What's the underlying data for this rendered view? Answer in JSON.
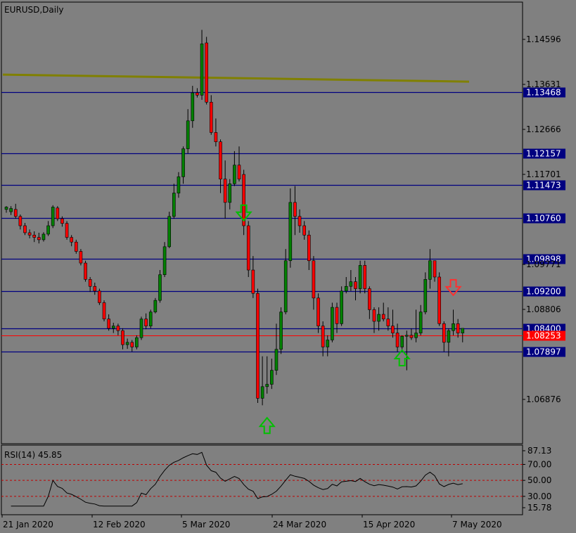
{
  "chart_data": {
    "type": "candlestick",
    "title": "EURUSD,Daily",
    "rsi_label": "RSI(14) 45.85",
    "price_ticks": [
      "1.14596",
      "1.13631",
      "1.12666",
      "1.11701",
      "1.09771",
      "1.08806",
      "1.06876"
    ],
    "horizontal_levels": [
      {
        "value": "1.13468",
        "price": 1.13468
      },
      {
        "value": "1.12157",
        "price": 1.12157
      },
      {
        "value": "1.11473",
        "price": 1.11473
      },
      {
        "value": "1.10760",
        "price": 1.1076
      },
      {
        "value": "1.09898",
        "price": 1.09898
      },
      {
        "value": "1.09200",
        "price": 1.092
      },
      {
        "value": "1.08400",
        "price": 1.084
      },
      {
        "value": "1.07897",
        "price": 1.07897
      }
    ],
    "current_price": {
      "value": "1.08253",
      "price": 1.08253
    },
    "ma_line": {
      "start": 1.1384,
      "end": 1.1369,
      "color": "#808000"
    },
    "rsi_ticks": [
      "87.13",
      "70.00",
      "50.00",
      "30.00",
      "15.78"
    ],
    "rsi_levels": [
      70,
      50,
      30
    ],
    "x_labels": [
      "21 Jan 2020",
      "12 Feb 2020",
      "5 Mar 2020",
      "24 Mar 2020",
      "15 Apr 2020",
      "7 May 2020"
    ],
    "candles": [
      [
        1.1095,
        1.11,
        1.1088,
        1.1102
      ],
      [
        1.109,
        1.1097,
        1.1083,
        1.1102
      ],
      [
        1.1095,
        1.108,
        1.1075,
        1.1107
      ],
      [
        1.108,
        1.106,
        1.1052,
        1.1084
      ],
      [
        1.106,
        1.1045,
        1.104,
        1.1066
      ],
      [
        1.1045,
        1.104,
        1.1033,
        1.1052
      ],
      [
        1.104,
        1.1035,
        1.1025,
        1.1048
      ],
      [
        1.1035,
        1.103,
        1.1022,
        1.1045
      ],
      [
        1.103,
        1.1042,
        1.1026,
        1.1046
      ],
      [
        1.1042,
        1.106,
        1.1038,
        1.107
      ],
      [
        1.106,
        1.11,
        1.1055,
        1.1104
      ],
      [
        1.1098,
        1.1075,
        1.107,
        1.1102
      ],
      [
        1.1075,
        1.1065,
        1.1058,
        1.108
      ],
      [
        1.1065,
        1.1035,
        1.103,
        1.107
      ],
      [
        1.1035,
        1.1025,
        1.1016,
        1.104
      ],
      [
        1.1025,
        1.1005,
        1.1,
        1.103
      ],
      [
        1.1005,
        1.098,
        1.0975,
        1.101
      ],
      [
        1.098,
        1.0945,
        1.094,
        1.0985
      ],
      [
        1.0945,
        1.093,
        1.0918,
        1.095
      ],
      [
        1.093,
        1.092,
        1.0912,
        1.0938
      ],
      [
        1.092,
        1.0895,
        1.089,
        1.0925
      ],
      [
        1.0895,
        1.086,
        1.0855,
        1.09
      ],
      [
        1.086,
        1.084,
        1.0835,
        1.087
      ],
      [
        1.084,
        1.0845,
        1.083,
        1.0852
      ],
      [
        1.0845,
        1.0835,
        1.0825,
        1.085
      ],
      [
        1.0835,
        1.0805,
        1.0795,
        1.084
      ],
      [
        1.0805,
        1.081,
        1.0796,
        1.0818
      ],
      [
        1.081,
        1.08,
        1.079,
        1.0815
      ],
      [
        1.08,
        1.082,
        1.0795,
        1.0825
      ],
      [
        1.082,
        1.086,
        1.0815,
        1.0865
      ],
      [
        1.086,
        1.0845,
        1.0838,
        1.0872
      ],
      [
        1.0845,
        1.0875,
        1.084,
        1.088
      ],
      [
        1.0875,
        1.09,
        1.0872,
        1.0905
      ],
      [
        1.09,
        1.0955,
        1.0895,
        1.0965
      ],
      [
        1.0955,
        1.1015,
        1.095,
        1.1025
      ],
      [
        1.1015,
        1.108,
        1.1012,
        1.109
      ],
      [
        1.108,
        1.113,
        1.1075,
        1.115
      ],
      [
        1.113,
        1.1165,
        1.112,
        1.1175
      ],
      [
        1.1165,
        1.1225,
        1.115,
        1.123
      ],
      [
        1.1225,
        1.1285,
        1.1215,
        1.131
      ],
      [
        1.1285,
        1.1345,
        1.127,
        1.136
      ],
      [
        1.1345,
        1.134,
        1.1335,
        1.1355
      ],
      [
        1.134,
        1.145,
        1.133,
        1.148
      ],
      [
        1.1452,
        1.1325,
        1.132,
        1.1465
      ],
      [
        1.1325,
        1.126,
        1.1255,
        1.134
      ],
      [
        1.126,
        1.124,
        1.123,
        1.129
      ],
      [
        1.124,
        1.116,
        1.113,
        1.1245
      ],
      [
        1.116,
        1.111,
        1.1075,
        1.12
      ],
      [
        1.111,
        1.115,
        1.1095,
        1.116
      ],
      [
        1.115,
        1.119,
        1.1145,
        1.122
      ],
      [
        1.119,
        1.116,
        1.1155,
        1.123
      ],
      [
        1.117,
        1.106,
        1.104,
        1.118
      ],
      [
        1.106,
        1.0965,
        1.095,
        1.107
      ],
      [
        1.0965,
        1.0915,
        1.0905,
        1.0995
      ],
      [
        1.0915,
        1.069,
        1.068,
        1.0925
      ],
      [
        1.069,
        1.0715,
        1.0675,
        1.078
      ],
      [
        1.0715,
        1.072,
        1.07,
        1.078
      ],
      [
        1.072,
        1.075,
        1.071,
        1.0775
      ],
      [
        1.075,
        1.0795,
        1.074,
        1.085
      ],
      [
        1.0795,
        1.0875,
        1.0785,
        1.0885
      ],
      [
        1.0875,
        1.0985,
        1.087,
        1.101
      ],
      [
        1.0985,
        1.111,
        1.097,
        1.114
      ],
      [
        1.111,
        1.108,
        1.104,
        1.1145
      ],
      [
        1.108,
        1.106,
        1.1045,
        1.1095
      ],
      [
        1.106,
        1.104,
        1.103,
        1.107
      ],
      [
        1.104,
        1.0985,
        1.0965,
        1.105
      ],
      [
        1.0985,
        1.0905,
        1.088,
        1.0995
      ],
      [
        1.0905,
        1.0845,
        1.083,
        1.0915
      ],
      [
        1.0845,
        1.08,
        1.078,
        1.0855
      ],
      [
        1.08,
        1.0815,
        1.078,
        1.0825
      ],
      [
        1.0815,
        1.0885,
        1.081,
        1.0895
      ],
      [
        1.0885,
        1.085,
        1.083,
        1.0895
      ],
      [
        1.085,
        1.092,
        1.0845,
        1.093
      ],
      [
        1.092,
        1.093,
        1.0915,
        1.095
      ],
      [
        1.093,
        1.094,
        1.092,
        1.0965
      ],
      [
        1.094,
        1.0925,
        1.09,
        1.095
      ],
      [
        1.0925,
        1.0975,
        1.0915,
        1.0985
      ],
      [
        1.0975,
        1.0925,
        1.0915,
        1.0985
      ],
      [
        1.0925,
        1.088,
        1.086,
        1.093
      ],
      [
        1.088,
        1.0855,
        1.083,
        1.0885
      ],
      [
        1.0855,
        1.087,
        1.0835,
        1.0885
      ],
      [
        1.087,
        1.086,
        1.0855,
        1.0895
      ],
      [
        1.086,
        1.0845,
        1.0835,
        1.0885
      ],
      [
        1.0845,
        1.083,
        1.082,
        1.088
      ],
      [
        1.083,
        1.08,
        1.079,
        1.085
      ],
      [
        1.08,
        1.0823,
        1.0795,
        1.0825
      ],
      [
        1.0823,
        1.0825,
        1.075,
        1.0835
      ],
      [
        1.0825,
        1.082,
        1.0815,
        1.084
      ],
      [
        1.082,
        1.083,
        1.081,
        1.088
      ],
      [
        1.083,
        1.0875,
        1.0825,
        1.089
      ],
      [
        1.0875,
        1.0945,
        1.087,
        1.096
      ],
      [
        1.0945,
        1.0985,
        1.0925,
        1.101
      ],
      [
        1.0985,
        1.095,
        1.094,
        1.0985
      ],
      [
        1.095,
        1.085,
        1.0845,
        1.096
      ],
      [
        1.085,
        1.081,
        1.079,
        1.0855
      ],
      [
        1.081,
        1.0835,
        1.078,
        1.084
      ],
      [
        1.0835,
        1.085,
        1.0825,
        1.088
      ],
      [
        1.085,
        1.083,
        1.082,
        1.086
      ],
      [
        1.083,
        1.084,
        1.081,
        1.084
      ]
    ],
    "bull_color": "#008000",
    "bear_color": "#ff0000",
    "arrows": [
      {
        "candle": 51,
        "price": 1.108,
        "direction": "down",
        "color": "#00c000"
      },
      {
        "candle": 56,
        "price": 1.063,
        "direction": "up",
        "color": "#00c000"
      },
      {
        "candle": 85,
        "price": 1.0775,
        "direction": "up",
        "color": "#00c000"
      },
      {
        "candle": 96,
        "price": 1.092,
        "direction": "down",
        "color": "#ff3030"
      }
    ]
  }
}
